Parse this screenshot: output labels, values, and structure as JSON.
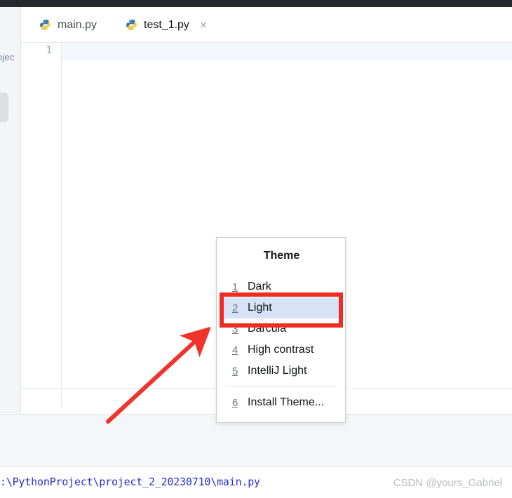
{
  "window": {
    "titlebar_color": "#26282e"
  },
  "toolwindow": {
    "label": "ojec"
  },
  "tabs": [
    {
      "label": "main.py",
      "icon": "python-file-icon",
      "active": false
    },
    {
      "label": "test_1.py",
      "icon": "python-file-icon",
      "active": true,
      "close_glyph": "×"
    }
  ],
  "editor": {
    "line_number": "1",
    "content": ""
  },
  "theme_popup": {
    "title": "Theme",
    "items": [
      {
        "mnemonic": "1",
        "label": "Dark",
        "selected": false
      },
      {
        "mnemonic": "2",
        "label": "Light",
        "selected": true
      },
      {
        "mnemonic": "3",
        "label": "Darcula",
        "selected": false
      },
      {
        "mnemonic": "4",
        "label": "High contrast",
        "selected": false
      },
      {
        "mnemonic": "5",
        "label": "IntelliJ Light",
        "selected": false
      },
      {
        "mnemonic": "6",
        "label": "Install Theme...",
        "selected": false
      }
    ],
    "selection_color": "#d6e3f7"
  },
  "annotations": {
    "highlight_color": "#f02b22",
    "arrow_color": "#f0332b"
  },
  "statusbar": {
    "path": ":\\PythonProject\\project_2_20230710\\main.py",
    "path_color": "#2b2ecb",
    "watermark": "CSDN @yours_Gabriel"
  }
}
